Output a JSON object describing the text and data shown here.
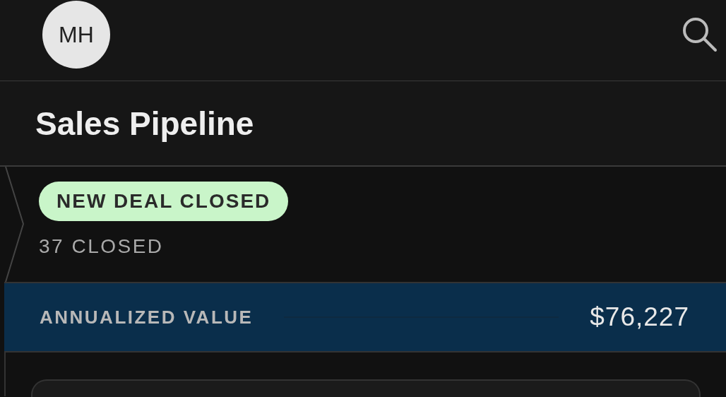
{
  "header": {
    "avatar_initials": "MH"
  },
  "title": "Sales Pipeline",
  "stage": {
    "badge": "NEW DEAL CLOSED",
    "count": "37 CLOSED"
  },
  "metric": {
    "label": "ANNUALIZED VALUE",
    "value": "$76,227"
  }
}
